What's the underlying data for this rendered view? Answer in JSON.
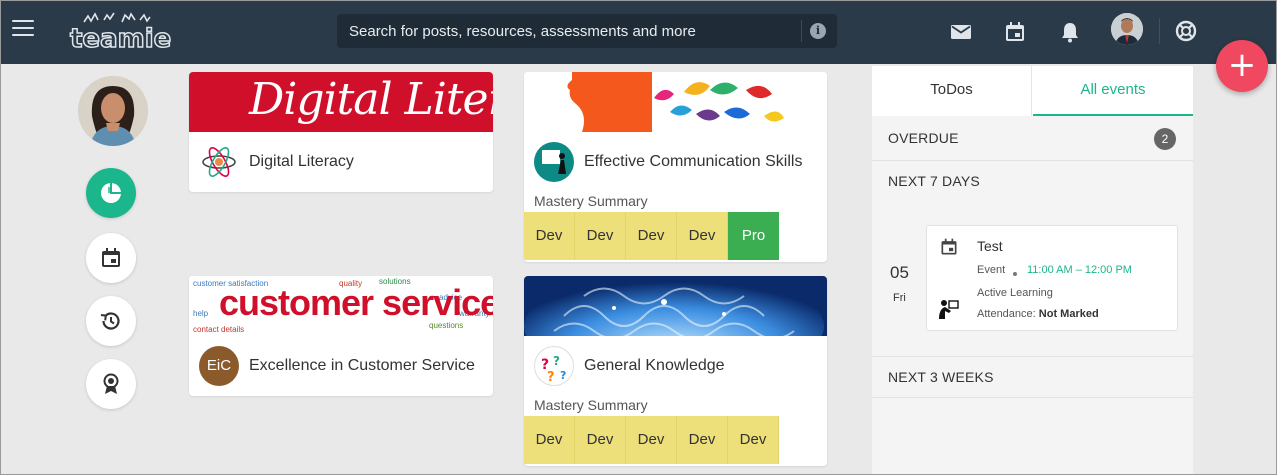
{
  "header": {
    "logo_text": "teamie",
    "search_placeholder": "Search for posts, resources, assessments and more",
    "icons": [
      "menu-icon",
      "mail-icon",
      "calendar-icon",
      "bell-icon",
      "help-icon"
    ]
  },
  "fab": {
    "label": "+"
  },
  "rail": {
    "items": [
      "dashboard-pie-icon",
      "calendar-icon",
      "history-icon",
      "badge-icon"
    ],
    "active_color": "#1cb68c"
  },
  "courses": [
    {
      "title": "Digital Literacy",
      "banner_text": "Digital Literacy",
      "has_mastery": false
    },
    {
      "title": "Effective Communication Skills",
      "has_mastery": true,
      "mastery_label": "Mastery Summary",
      "mastery": [
        "Dev",
        "Dev",
        "Dev",
        "Dev",
        "Pro"
      ]
    },
    {
      "title": "Excellence in Customer Service",
      "banner_text": "customer service",
      "icon_text": "EiC",
      "has_mastery": false
    },
    {
      "title": "General Knowledge",
      "has_mastery": true,
      "mastery_label": "Mastery Summary",
      "mastery": [
        "Dev",
        "Dev",
        "Dev",
        "Dev",
        "Dev"
      ]
    }
  ],
  "panel": {
    "tabs": [
      "ToDos",
      "All events"
    ],
    "active_tab": "All events",
    "overdue": {
      "label": "OVERDUE",
      "count": "2"
    },
    "next7": {
      "label": "NEXT 7 DAYS"
    },
    "next3": {
      "label": "NEXT 3 WEEKS"
    },
    "event": {
      "day": "05",
      "weekday": "Fri",
      "title": "Test",
      "type": "Event",
      "time": "11:00 AM – 12:00 PM",
      "group": "Active Learning",
      "attendance_label": "Attendance:",
      "attendance_value": "Not Marked"
    }
  },
  "colors": {
    "topbar": "#2b3a48",
    "accent": "#1cb68c",
    "fab": "#f04860",
    "mastery_dev": "#ede07a",
    "mastery_pro": "#3cae52"
  }
}
